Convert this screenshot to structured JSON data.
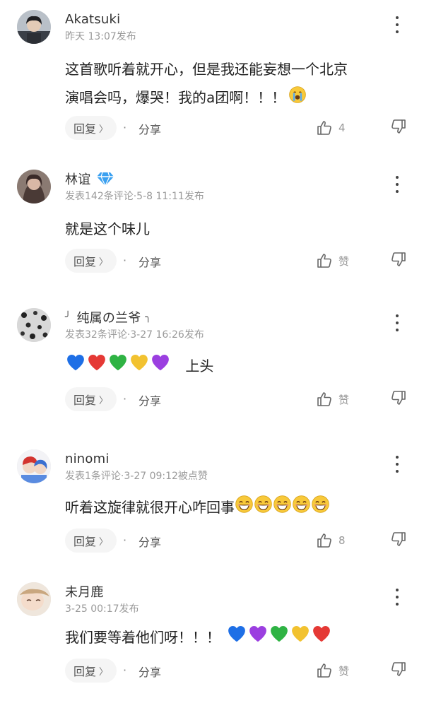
{
  "comments": [
    {
      "user": "Akatsuki",
      "meta": "昨天 13:07发布",
      "text_line1": "这首歌听着就开心，但是我还能妄想一个北京",
      "text_line2": "演唱会吗，爆哭！我的a团啊！！！",
      "reply_label": "回复",
      "share_label": "分享",
      "like_count": "4"
    },
    {
      "user": "林谊",
      "meta": "发表142条评论·5-8 11:11发布",
      "text": "就是这个味儿",
      "reply_label": "回复",
      "share_label": "分享",
      "like_count": "赞"
    },
    {
      "user": "纯属の兰爷",
      "user_prefix": "╯",
      "user_suffix": "╮",
      "meta": "发表32条评论·3-27 16:26发布",
      "text": "上头",
      "reply_label": "回复",
      "share_label": "分享",
      "like_count": "赞"
    },
    {
      "user": "ninomi",
      "meta": "发表1条评论·3-27 09:12被点赞",
      "text": "听着这旋律就很开心咋回事",
      "reply_label": "回复",
      "share_label": "分享",
      "like_count": "8"
    },
    {
      "user": "未月鹿",
      "meta": "3-25 00:17发布",
      "text": "我们要等着他们呀！！！",
      "reply_label": "回复",
      "share_label": "分享",
      "like_count": "赞"
    }
  ],
  "icons": {
    "more": "more-vertical-icon",
    "like": "thumbs-up-icon",
    "dislike": "thumbs-down-icon",
    "vip": "diamond-badge-icon",
    "heart_colors": [
      "#1e6fe6",
      "#e53935",
      "#2fb344",
      "#f2c230",
      "#9b3fe0"
    ],
    "heart_colors_last": [
      "#1e6fe6",
      "#9b3fe0",
      "#2fb344",
      "#f2c230",
      "#e53935"
    ]
  },
  "separator": "·",
  "chevron": "〉"
}
